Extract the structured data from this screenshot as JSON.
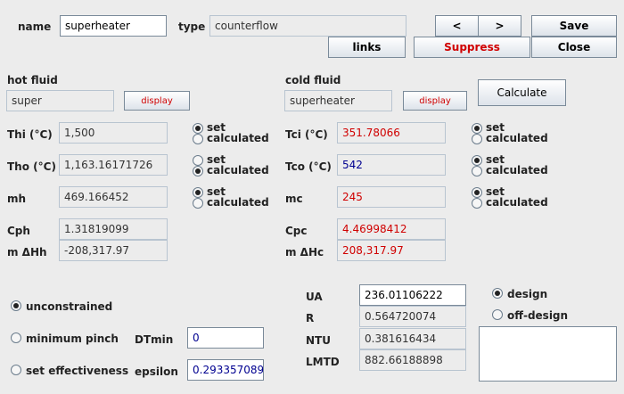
{
  "header": {
    "name_label": "name",
    "name_value": "superheater",
    "type_label": "type",
    "type_value": "counterflow",
    "prev_label": "<",
    "next_label": ">",
    "save_label": "Save",
    "links_label": "links",
    "suppress_label": "Suppress",
    "close_label": "Close"
  },
  "hot": {
    "title": "hot fluid",
    "fluid": "super",
    "display_label": "display",
    "thi_label": "Thi (°C)",
    "thi_value": "1,500",
    "tho_label": "Tho (°C)",
    "tho_value": "1,163.16171726",
    "mh_label": "mh",
    "mh_value": "469.166452",
    "cph_label": "Cph",
    "cph_value": "1.31819099",
    "dh_label": "m ΔHh",
    "dh_value": "-208,317.97"
  },
  "cold": {
    "title": "cold fluid",
    "fluid": "superheater",
    "display_label": "display",
    "calculate_label": "Calculate",
    "tci_label": "Tci (°C)",
    "tci_value": "351.78066",
    "tco_label": "Tco (°C)",
    "tco_value": "542",
    "mc_label": "mc",
    "mc_value": "245",
    "cpc_label": "Cpc",
    "cpc_value": "4.46998412",
    "dh_label": "m ΔHc",
    "dh_value": "208,317.97"
  },
  "radio_labels": {
    "set": "set",
    "calculated": "calculated"
  },
  "constraints": {
    "unconstrained": "unconstrained",
    "min_pinch": "minimum pinch",
    "set_eff": "set effectiveness",
    "dtmin_label": "DTmin",
    "dtmin_value": "0",
    "epsilon_label": "epsilon",
    "epsilon_value": "0.293357089"
  },
  "results": {
    "ua_label": "UA",
    "ua_value": "236.01106222",
    "r_label": "R",
    "r_value": "0.564720074",
    "ntu_label": "NTU",
    "ntu_value": "0.381616434",
    "lmtd_label": "LMTD",
    "lmtd_value": "882.66188898"
  },
  "mode": {
    "design": "design",
    "off_design": "off-design"
  }
}
